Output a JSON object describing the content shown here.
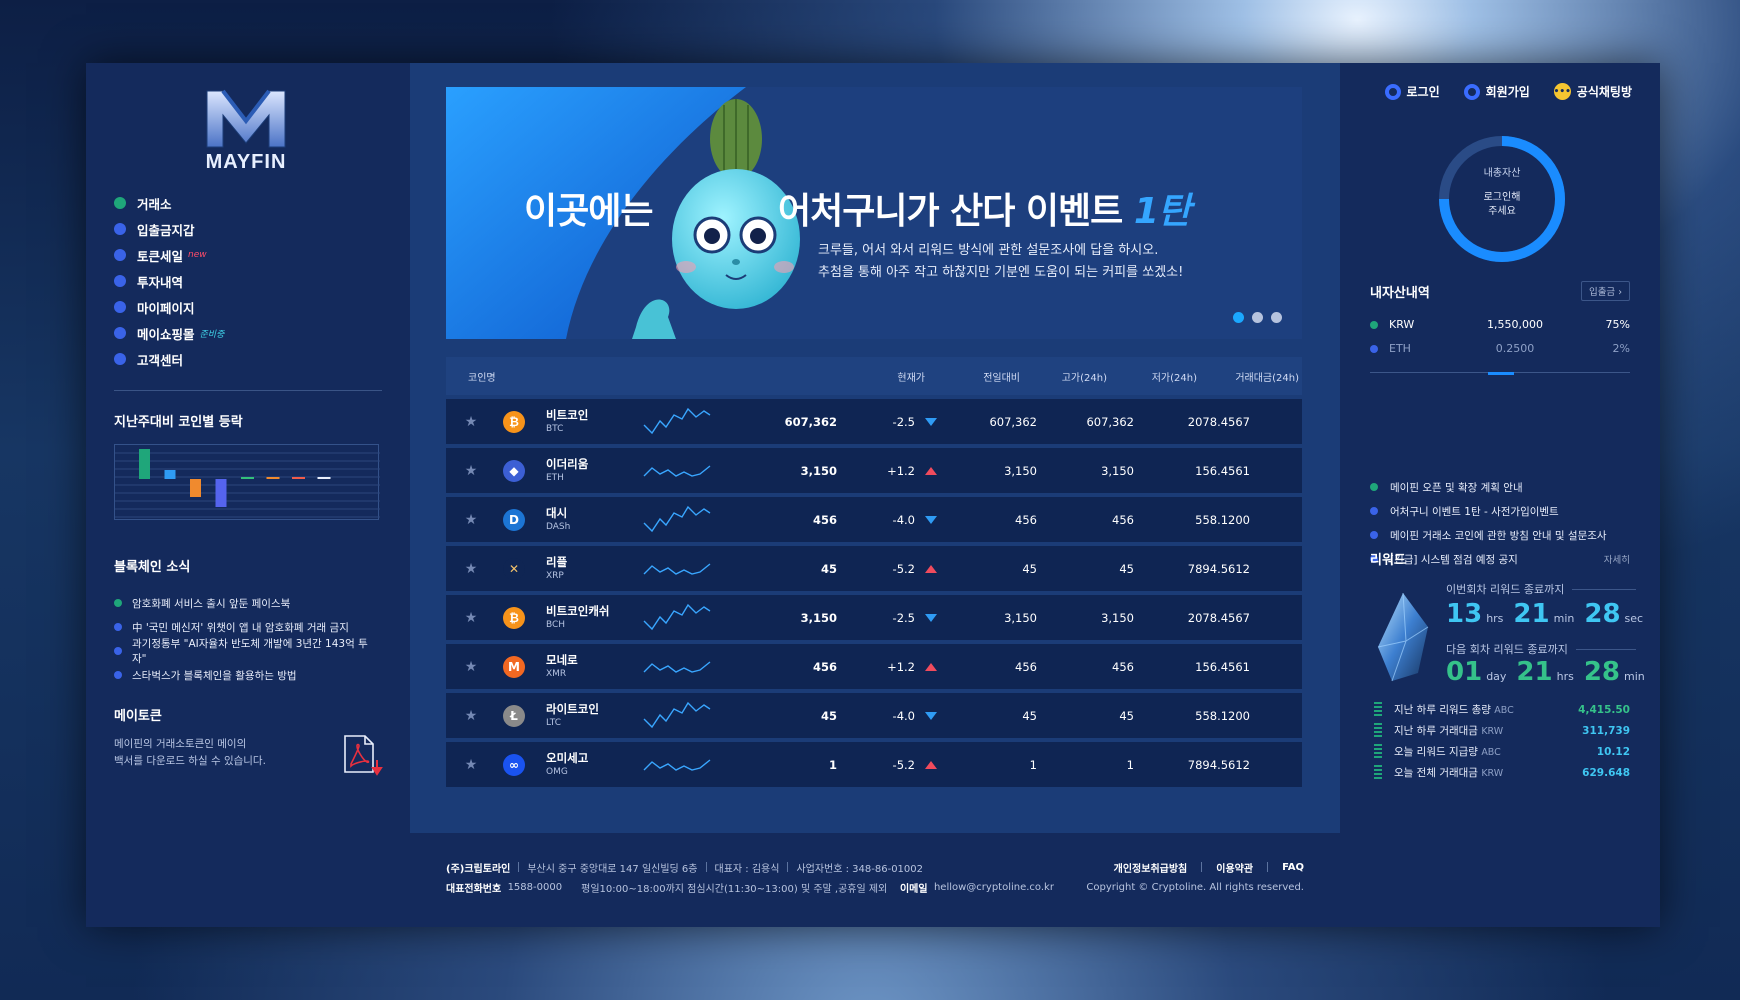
{
  "brand": {
    "name": "MAYFIN"
  },
  "menu": [
    {
      "label": "거래소",
      "color": "#1fa67a",
      "tag": ""
    },
    {
      "label": "입출금지갑",
      "color": "#3a63e8",
      "tag": ""
    },
    {
      "label": "토큰세일",
      "color": "#3a63e8",
      "tag": "new"
    },
    {
      "label": "투자내역",
      "color": "#3a63e8",
      "tag": ""
    },
    {
      "label": "마이페이지",
      "color": "#3a63e8",
      "tag": ""
    },
    {
      "label": "메이쇼핑몰",
      "color": "#3a63e8",
      "tag": "준비중"
    },
    {
      "label": "고객센터",
      "color": "#3a63e8",
      "tag": ""
    }
  ],
  "weekly": {
    "title": "지난주대비 코인별 등락",
    "bars": [
      {
        "value": 3.0,
        "color": "#1fa67a"
      },
      {
        "value": 0.9,
        "color": "#2f9cf5"
      },
      {
        "value": -1.8,
        "color": "#f08a2e"
      },
      {
        "value": -2.8,
        "color": "#5564ee"
      },
      {
        "value": 0.15,
        "color": "#33c07a"
      },
      {
        "value": 0.15,
        "color": "#f08a2e"
      },
      {
        "value": 0.15,
        "color": "#f05c4a"
      },
      {
        "value": 0.15,
        "color": "#e9eefb"
      }
    ]
  },
  "blockchain_news": {
    "title": "블록체인 소식",
    "items": [
      "암호화폐 서비스 출시 앞둔 페이스북",
      "中 '국민 메신저' 위챗이 앱 내 암호화폐 거래 금지",
      "과기정통부 \"AI자율차 반도체 개발에 3년간 143억 투자\"",
      "스타벅스가 블록체인을 활용하는 방법"
    ]
  },
  "maytoken": {
    "title": "메이토큰",
    "desc1": "메이핀의 거래소토큰인 메이의",
    "desc2": "백서를 다운로드 하실 수 있습니다."
  },
  "banner": {
    "title_left": "이곳에는",
    "title_right": "어처구니가 산다 이벤트",
    "title_accent": "1탄",
    "desc1": "크루들, 어서 와서 리워드 방식에 관한 설문조사에 답을 하시오.",
    "desc2": "추첨을 통해 아주 작고 하찮지만 기분엔 도움이 되는 커피를 쏘겠소!"
  },
  "table": {
    "headers": {
      "name": "코인명",
      "price": "현재가",
      "change": "전일대비",
      "high": "고가(24h)",
      "low": "저가(24h)",
      "volume": "거래대금(24h)"
    },
    "rows": [
      {
        "name": "비트코인",
        "symbol": "BTC",
        "icon": "bitcoin-icon",
        "glyph": "₿",
        "color": "#f7931a",
        "price": "607,362",
        "change": "-2.5",
        "dir": "down",
        "high": "607,362",
        "low": "607,362",
        "volume": "2078.4567"
      },
      {
        "name": "이더리움",
        "symbol": "ETH",
        "icon": "ethereum-icon",
        "glyph": "◆",
        "color": "#3c5fd4",
        "price": "3,150",
        "change": "+1.2",
        "dir": "up",
        "high": "3,150",
        "low": "3,150",
        "volume": "156.4561"
      },
      {
        "name": "대시",
        "symbol": "DASh",
        "icon": "dash-icon",
        "glyph": "D",
        "color": "#1c75d4",
        "price": "456",
        "change": "-4.0",
        "dir": "down",
        "high": "456",
        "low": "456",
        "volume": "558.1200"
      },
      {
        "name": "리플",
        "symbol": "XRP",
        "icon": "ripple-icon",
        "glyph": "✕",
        "color": "#0f2553",
        "price": "45",
        "change": "-5.2",
        "dir": "up",
        "high": "45",
        "low": "45",
        "volume": "7894.5612"
      },
      {
        "name": "비트코인캐쉬",
        "symbol": "BCH",
        "icon": "bitcoin-cash-icon",
        "glyph": "₿",
        "color": "#f7931a",
        "price": "3,150",
        "change": "-2.5",
        "dir": "down",
        "high": "3,150",
        "low": "3,150",
        "volume": "2078.4567"
      },
      {
        "name": "모네로",
        "symbol": "XMR",
        "icon": "monero-icon",
        "glyph": "M",
        "color": "#f26822",
        "price": "456",
        "change": "+1.2",
        "dir": "up",
        "high": "456",
        "low": "456",
        "volume": "156.4561"
      },
      {
        "name": "라이트코인",
        "symbol": "LTC",
        "icon": "litecoin-icon",
        "glyph": "Ł",
        "color": "#8a8a8a",
        "price": "45",
        "change": "-4.0",
        "dir": "down",
        "high": "45",
        "low": "45",
        "volume": "558.1200"
      },
      {
        "name": "오미세고",
        "symbol": "OMG",
        "icon": "omisego-icon",
        "glyph": "∞",
        "color": "#1a53f0",
        "price": "1",
        "change": "-5.2",
        "dir": "up",
        "high": "1",
        "low": "1",
        "volume": "7894.5612"
      }
    ]
  },
  "footer": {
    "company": "(주)크립토라인",
    "address": "부산시 중구 중앙대로 147 일신빌딩 6층",
    "ceo": "대표자 : 김용식",
    "bizno": "사업자번호 : 348-86-01002",
    "phone_label": "대표전화번호",
    "phone": "1588-0000",
    "hours": "평일10:00~18:00까지 점심시간(11:30~13:00) 및 주말 ,공휴일 제외",
    "email_label": "이메일",
    "email": "hellow@cryptoline.co.kr",
    "links": [
      "개인정보취급방침",
      "이용약관",
      "FAQ"
    ],
    "copyright": "Copyright © Cryptoline. All rights reserved."
  },
  "top_links": {
    "login": "로그인",
    "signup": "회원가입",
    "chat": "공식채팅방"
  },
  "total_asset": {
    "label": "내총자산",
    "msg1": "로그인해",
    "msg2": "주세요"
  },
  "my_assets": {
    "title": "내자산내역",
    "button": "입출금 ›",
    "rows": [
      {
        "symbol": "KRW",
        "amount": "1,550,000",
        "pct": "75%",
        "color": "#1fa67a"
      },
      {
        "symbol": "ETH",
        "amount": "0.2500",
        "pct": "2%",
        "color": "#3a63e8"
      }
    ]
  },
  "notices": [
    {
      "text": "메이핀 오픈 및 확장 계획 안내",
      "color": "#1fa67a"
    },
    {
      "text": "어처구니 이벤트 1탄 - 사전가입이벤트",
      "color": "#3a63e8"
    },
    {
      "text": "메이핀 거래소 코인에 관한 방침 안내 및 설문조사",
      "color": "#3a63e8"
    },
    {
      "text": "[긴급] 시스템 점검 예정 공지",
      "color": "#3a63e8"
    }
  ],
  "reward": {
    "title": "리워드",
    "more": "자세히",
    "current_label": "이번회차 리워드 종료까지",
    "current": {
      "a": "13",
      "a_unit": "hrs",
      "b": "21",
      "b_unit": "min",
      "c": "28",
      "c_unit": "sec"
    },
    "next_label": "다음 회차 리워드 종료까지",
    "next": {
      "a": "01",
      "a_unit": "day",
      "b": "21",
      "b_unit": "hrs",
      "c": "28",
      "c_unit": "min"
    },
    "stats": [
      {
        "label": "지난 하루 리워드 총량",
        "unit": "ABC",
        "value": "4,415.50",
        "color": "#35c28a"
      },
      {
        "label": "지난 하루 거래대금",
        "unit": "KRW",
        "value": "311,739",
        "color": "#3fc6f2"
      },
      {
        "label": "오늘 리워드 지급량",
        "unit": "ABC",
        "value": "10.12",
        "color": "#3fc6f2"
      },
      {
        "label": "오늘 전체 거래대금",
        "unit": "KRW",
        "value": "629.648",
        "color": "#3fc6f2"
      }
    ]
  }
}
